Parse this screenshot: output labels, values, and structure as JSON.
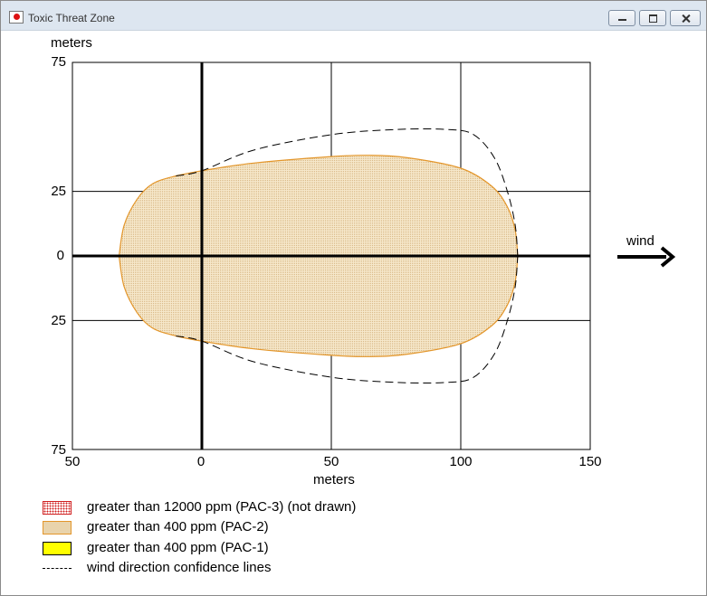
{
  "window": {
    "title": "Toxic Threat Zone"
  },
  "chart_data": {
    "type": "area",
    "title": "",
    "xlabel": "meters",
    "ylabel": "meters",
    "xlim": [
      -50,
      150
    ],
    "ylim": [
      -75,
      75
    ],
    "x_tick_labels": [
      "50",
      "0",
      "50",
      "100",
      "150"
    ],
    "y_tick_labels": [
      "75",
      "25",
      "0",
      "25",
      "75"
    ],
    "wind_label": "wind",
    "pac2_zone_upper": [
      {
        "x": -32,
        "y": 0
      },
      {
        "x": -30,
        "y": 12
      },
      {
        "x": -25,
        "y": 22
      },
      {
        "x": -19,
        "y": 28
      },
      {
        "x": -10,
        "y": 31
      },
      {
        "x": 0,
        "y": 33
      },
      {
        "x": 20,
        "y": 36
      },
      {
        "x": 50,
        "y": 38.5
      },
      {
        "x": 65,
        "y": 39
      },
      {
        "x": 80,
        "y": 38
      },
      {
        "x": 100,
        "y": 34
      },
      {
        "x": 112,
        "y": 27
      },
      {
        "x": 118,
        "y": 19
      },
      {
        "x": 121,
        "y": 10
      },
      {
        "x": 122,
        "y": 0
      }
    ],
    "pac2_zone_lower": [
      {
        "x": 122,
        "y": 0
      },
      {
        "x": 121,
        "y": -10
      },
      {
        "x": 118,
        "y": -19
      },
      {
        "x": 112,
        "y": -27
      },
      {
        "x": 100,
        "y": -34
      },
      {
        "x": 80,
        "y": -38
      },
      {
        "x": 65,
        "y": -39
      },
      {
        "x": 50,
        "y": -38.5
      },
      {
        "x": 20,
        "y": -36
      },
      {
        "x": 0,
        "y": -33
      },
      {
        "x": -10,
        "y": -31
      },
      {
        "x": -19,
        "y": -28
      },
      {
        "x": -25,
        "y": -22
      },
      {
        "x": -30,
        "y": -12
      },
      {
        "x": -32,
        "y": 0
      }
    ],
    "confidence_upper": [
      {
        "x": -10,
        "y": 31
      },
      {
        "x": 0,
        "y": 33
      },
      {
        "x": 20,
        "y": 41
      },
      {
        "x": 50,
        "y": 47
      },
      {
        "x": 75,
        "y": 49
      },
      {
        "x": 95,
        "y": 49
      },
      {
        "x": 105,
        "y": 47
      },
      {
        "x": 113,
        "y": 38
      },
      {
        "x": 118,
        "y": 25
      },
      {
        "x": 121,
        "y": 12
      },
      {
        "x": 122,
        "y": 0
      }
    ],
    "confidence_lower": [
      {
        "x": -10,
        "y": -31
      },
      {
        "x": 0,
        "y": -33
      },
      {
        "x": 20,
        "y": -41
      },
      {
        "x": 50,
        "y": -47
      },
      {
        "x": 75,
        "y": -49
      },
      {
        "x": 95,
        "y": -49
      },
      {
        "x": 105,
        "y": -47
      },
      {
        "x": 113,
        "y": -38
      },
      {
        "x": 118,
        "y": -25
      },
      {
        "x": 121,
        "y": -12
      },
      {
        "x": 122,
        "y": 0
      }
    ],
    "colors": {
      "pac3": "#d02020",
      "pac2_fill": "#f3dfb8",
      "pac2_border": "#e3962b",
      "pac1": "#ffff00"
    }
  },
  "legend": {
    "pac3": "greater than 12000 ppm (PAC-3) (not drawn)",
    "pac2": "greater than 400 ppm (PAC-2)",
    "pac1": "greater than 400 ppm (PAC-1)",
    "confidence": "wind direction confidence lines"
  }
}
